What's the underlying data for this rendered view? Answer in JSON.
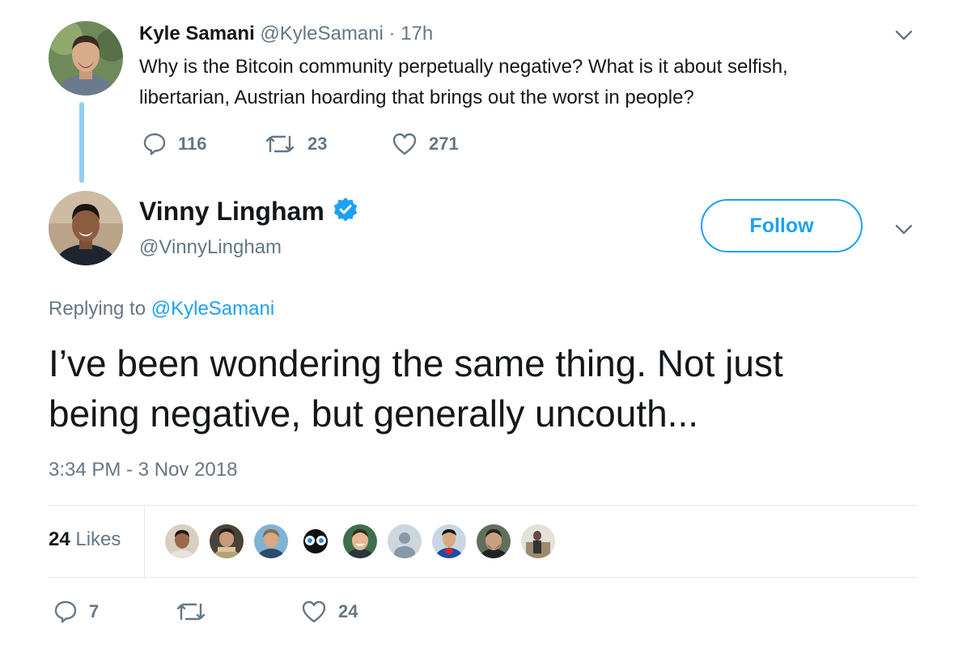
{
  "parent_tweet": {
    "name": "Kyle Samani",
    "handle": "@KyleSamani",
    "separator": "·",
    "time": "17h",
    "text_line1": "Why is the Bitcoin community perpetually negative? What is it about selfish,",
    "text_line2": "libertarian, Austrian hoarding that brings out the worst in people?",
    "replies": "116",
    "retweets": "23",
    "likes": "271"
  },
  "main_tweet": {
    "name": "Vinny Lingham",
    "handle": "@VinnyLingham",
    "follow_label": "Follow",
    "replying_prefix": "Replying to",
    "replying_handle": "@KyleSamani",
    "text_line1": "I’ve been wondering the same thing. Not just",
    "text_line2": "being negative, but generally uncouth...",
    "timestamp": "3:34 PM - 3 Nov 2018",
    "likes_count": "24",
    "likes_label": "Likes",
    "replies": "7",
    "retweets": "",
    "likes": "24"
  },
  "colors": {
    "accent": "#1da1f2",
    "muted": "#657786",
    "thread_line": "#8fd0f3",
    "text": "#14171a"
  },
  "icons": {
    "reply": "reply-icon",
    "retweet": "retweet-icon",
    "like": "heart-icon",
    "verified": "verified-badge-icon",
    "menu": "chevron-down-icon"
  }
}
